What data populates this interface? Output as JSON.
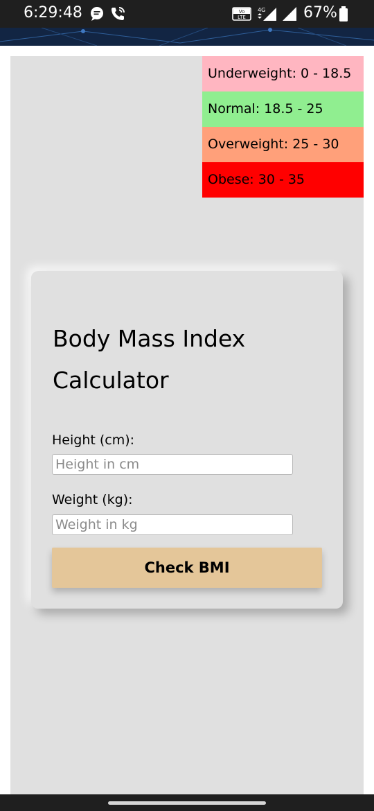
{
  "status_bar": {
    "time": "6:29:48",
    "battery_percent": "67%",
    "network_label": "4G",
    "volte_label": "VoLTE"
  },
  "legend": [
    {
      "label": "Underweight: 0 - 18.5",
      "color": "#ffb6c1"
    },
    {
      "label": "Normal: 18.5 - 25",
      "color": "#90ee90"
    },
    {
      "label": "Overweight: 25 - 30",
      "color": "#ffa07a"
    },
    {
      "label": "Obese: 30 - 35",
      "color": "#ff0000"
    }
  ],
  "card": {
    "title": "Body Mass Index Calculator",
    "height_label": "Height (cm):",
    "height_placeholder": "Height in cm",
    "height_value": "",
    "weight_label": "Weight (kg):",
    "weight_placeholder": "Weight in kg",
    "weight_value": "",
    "button_label": "Check BMI"
  },
  "colors": {
    "page_background": "#e0e0e0",
    "button_background": "#e4c699",
    "status_bar": "#1f1f1f",
    "banner": "#122543"
  }
}
